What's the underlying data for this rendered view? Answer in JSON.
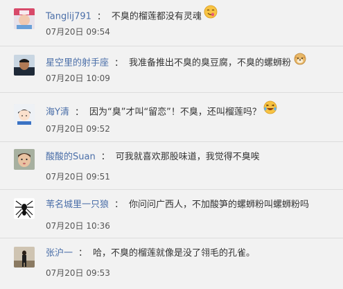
{
  "comments": [
    {
      "username": "Tanglij791",
      "colon": "：",
      "text": "不臭的榴莲都没有灵魂",
      "emoji": "yummy-face-emoji",
      "timestamp": "07月20日 09:54"
    },
    {
      "username": "星空里的射手座",
      "colon": "：",
      "text": "我准备推出不臭的臭豆腐，不臭的螺蛳粉",
      "emoji": "doge-emoji",
      "timestamp": "07月20日 10:09"
    },
    {
      "username": "海Y清",
      "colon": "：",
      "text": "因为“臭”才叫“留恋”！不臭，还叫榴莲吗？",
      "emoji": "laughing-tears-emoji",
      "timestamp": "07月20日 09:52"
    },
    {
      "username": "酸酸的Suan",
      "colon": "：",
      "text": "可我就喜欢那股味道，我觉得不臭唉",
      "emoji": "",
      "timestamp": "07月20日 09:51"
    },
    {
      "username": "苇名城里一只狼",
      "colon": "：",
      "text": "你问问广西人，不加酸笋的螺蛳粉叫螺蛳粉吗",
      "emoji": "",
      "timestamp": "07月20日 10:36"
    },
    {
      "username": "张沪一",
      "colon": "：",
      "text": "哈，不臭的榴莲就像是没了翎毛的孔雀。",
      "emoji": "",
      "timestamp": "07月20日 09:53"
    }
  ],
  "colors": {
    "background": "#f2f2f2",
    "username": "#4a6ea8",
    "text": "#333333",
    "timestamp": "#555555",
    "divider": "#dcdcdc"
  }
}
